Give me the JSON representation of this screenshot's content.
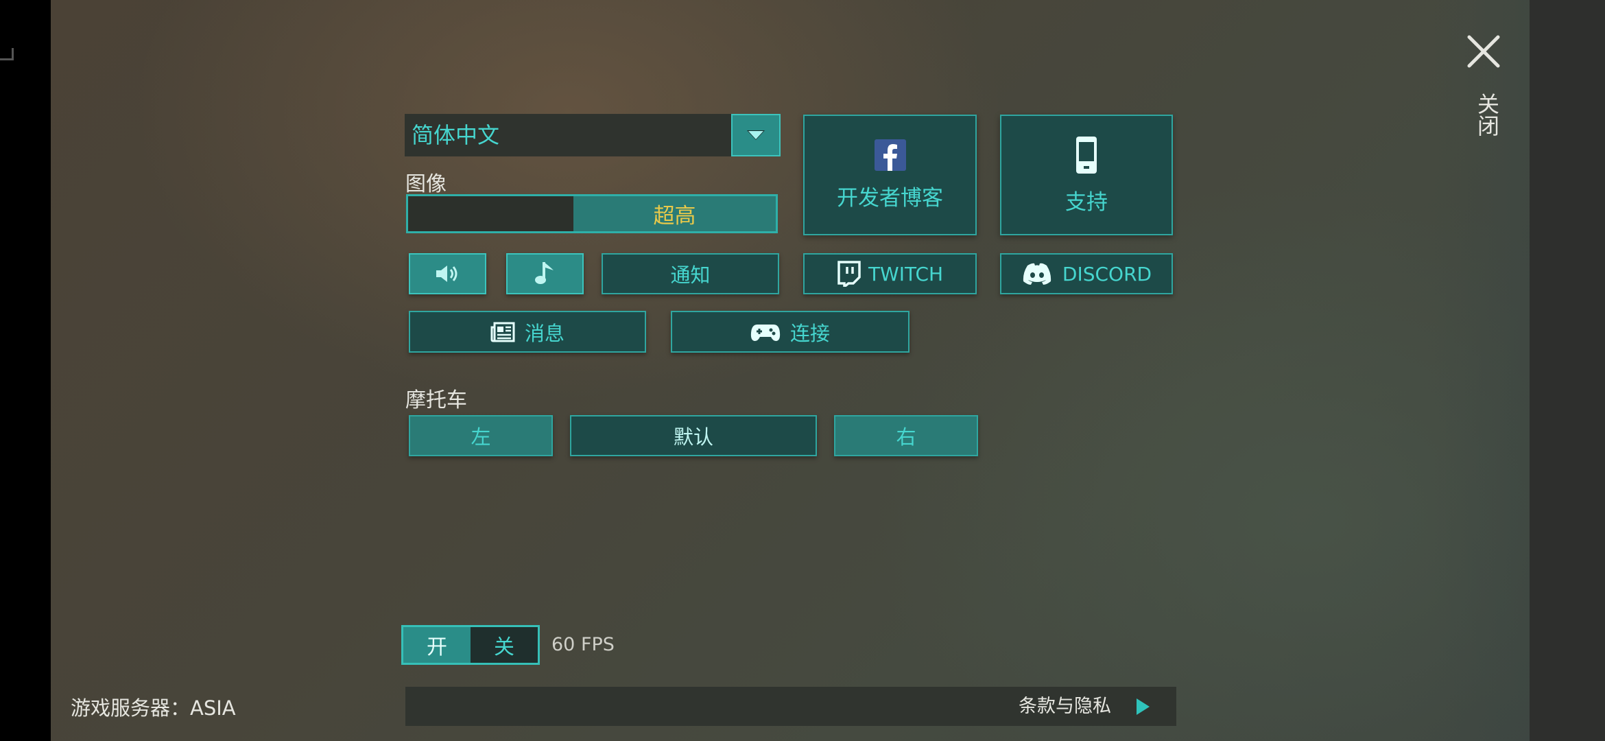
{
  "language": {
    "selected": "简体中文"
  },
  "graphics": {
    "label": "图像",
    "value": "超高",
    "level_fraction": 0.45
  },
  "buttons": {
    "notify": "通知",
    "news": "消息",
    "connect": "连接",
    "twitch": "TWITCH",
    "discord": "DISCORD",
    "dev_blog": "开发者博客",
    "support": "支持"
  },
  "motorcycle": {
    "label": "摩托车",
    "left": "左",
    "default": "默认",
    "right": "右"
  },
  "fps": {
    "on": "开",
    "off": "关",
    "value": "60 FPS"
  },
  "terms": {
    "label": "条款与隐私"
  },
  "server": {
    "label": "游戏服务器：ASIA"
  },
  "close": {
    "label": "关闭"
  },
  "colors": {
    "accent": "#46d6cf",
    "button_bg": "#1d4a48",
    "highlight_text": "#e8c94a",
    "facebook_blue": "#3b5998"
  },
  "icons": [
    "chevron-down-icon",
    "speaker-icon",
    "music-note-icon",
    "newspaper-icon",
    "gamepad-icon",
    "twitch-icon",
    "discord-icon",
    "facebook-icon",
    "phone-icon",
    "play-arrow-icon",
    "close-icon"
  ]
}
